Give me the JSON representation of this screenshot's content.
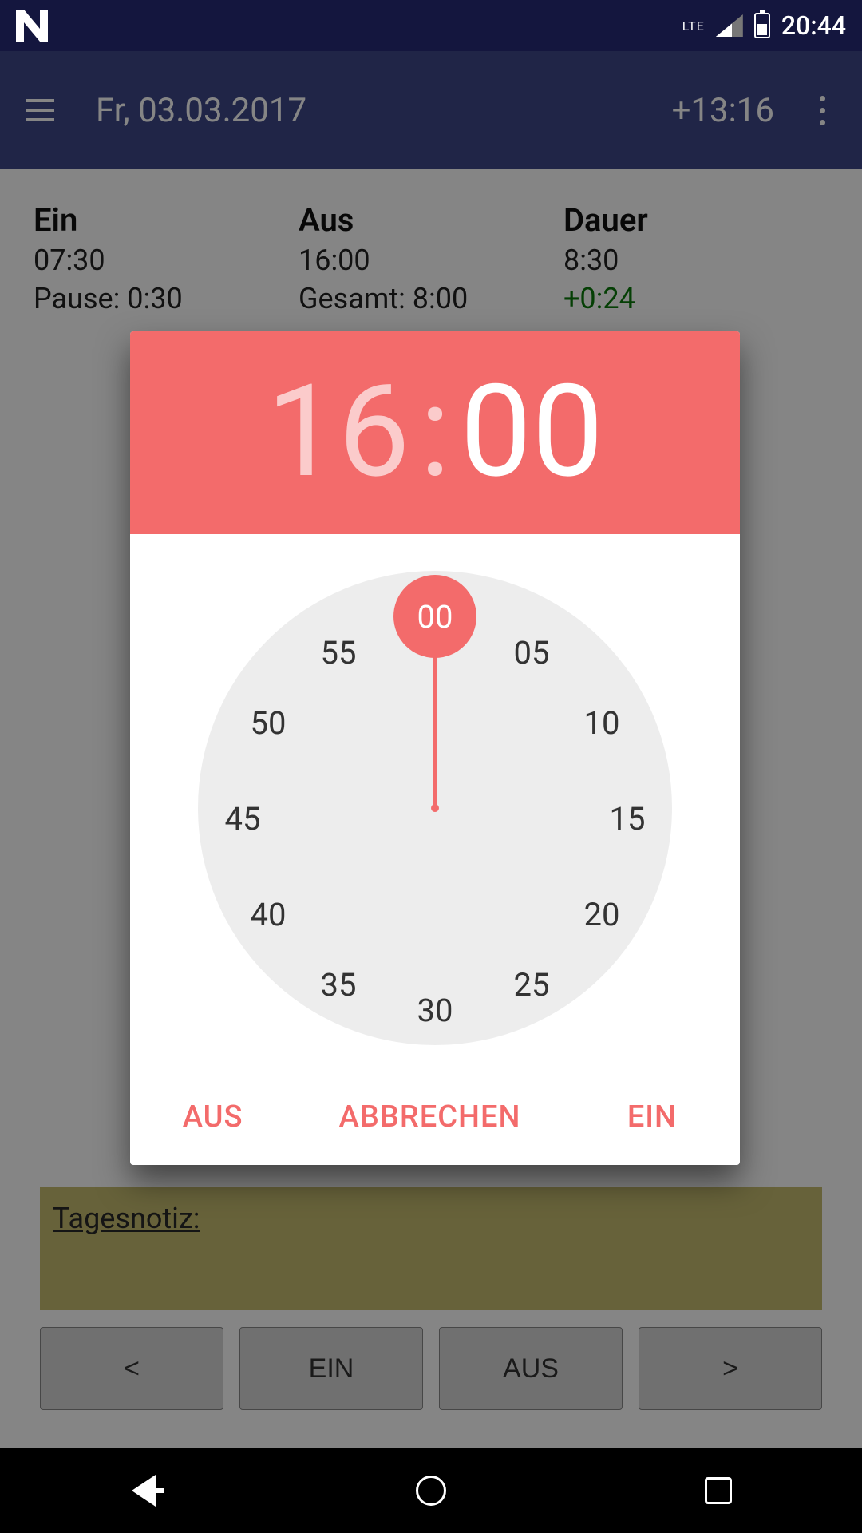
{
  "status": {
    "time": "20:44",
    "network_label": "LTE"
  },
  "appbar": {
    "title": "Fr, 03.03.2017",
    "balance": "+13:16"
  },
  "summary": {
    "ein": {
      "label": "Ein",
      "value": "07:30",
      "sub": "Pause: 0:30"
    },
    "aus": {
      "label": "Aus",
      "value": "16:00",
      "sub": "Gesamt: 8:00"
    },
    "dauer": {
      "label": "Dauer",
      "value": "8:30",
      "sub": "+0:24"
    }
  },
  "note": {
    "label": "Tagesnotiz:"
  },
  "bottom_buttons": {
    "prev": "<",
    "ein": "EIN",
    "aus": "AUS",
    "next": ">"
  },
  "timepicker": {
    "hour": "16",
    "colon": ":",
    "minute": "00",
    "selected_tick": "00",
    "ticks": [
      "05",
      "10",
      "15",
      "20",
      "25",
      "30",
      "35",
      "40",
      "45",
      "50",
      "55"
    ],
    "actions": {
      "aus": "AUS",
      "cancel": "ABBRECHEN",
      "ein": "EIN"
    }
  }
}
